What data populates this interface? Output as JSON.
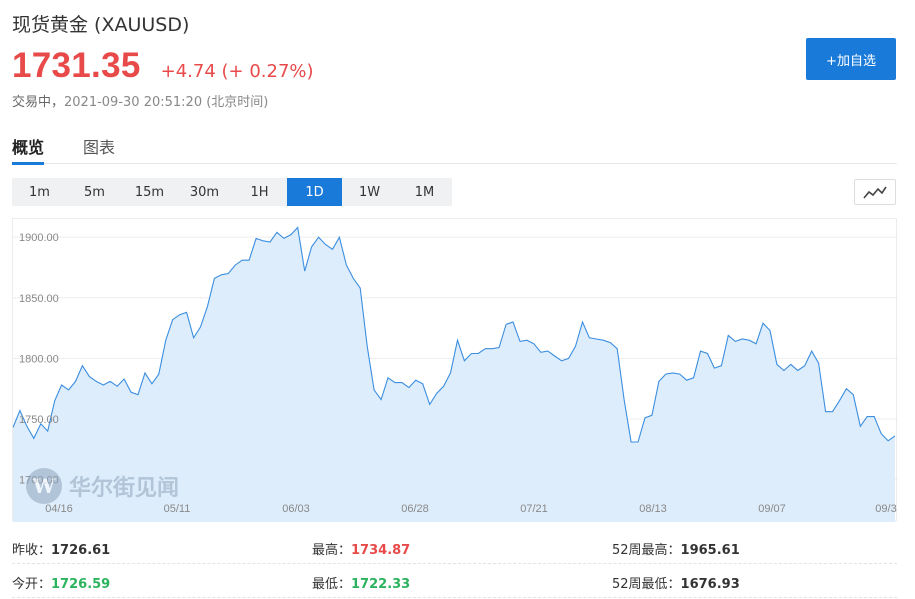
{
  "header": {
    "title": "现货黄金 (XAUUSD)",
    "price": "1731.35",
    "change": "+4.74 (+ 0.27%)",
    "status_label": "交易中，",
    "timestamp": "2021-09-30 20:51:20",
    "timezone": "(北京时间)",
    "add_button": "+加自选",
    "accent_color": "#1a7ad9",
    "up_color": "#e84a4a",
    "down_color": "#2bb35e"
  },
  "tabs": [
    {
      "label": "概览",
      "active": true
    },
    {
      "label": "图表",
      "active": false
    }
  ],
  "periods": [
    {
      "label": "1m",
      "active": false
    },
    {
      "label": "5m",
      "active": false
    },
    {
      "label": "15m",
      "active": false
    },
    {
      "label": "30m",
      "active": false
    },
    {
      "label": "1H",
      "active": false
    },
    {
      "label": "1D",
      "active": true
    },
    {
      "label": "1W",
      "active": false
    },
    {
      "label": "1M",
      "active": false
    }
  ],
  "chart_type_icon": "line-chart-icon",
  "watermark": "华尔街见闻",
  "chart_data": {
    "type": "area",
    "x_ticks": [
      "04/16",
      "05/11",
      "06/03",
      "06/28",
      "07/21",
      "08/13",
      "09/07",
      "09/3"
    ],
    "y_ticks": [
      "1900.00",
      "1850.00",
      "1800.00",
      "1750.00",
      "1700.00"
    ],
    "ylim": [
      1665,
      1915
    ],
    "grid": true,
    "line_color": "#3b8ee0",
    "fill_color": "#deedfb",
    "values": [
      1743,
      1757,
      1744,
      1734,
      1746,
      1740,
      1765,
      1778,
      1774,
      1781,
      1794,
      1785,
      1781,
      1778,
      1781,
      1777,
      1783,
      1772,
      1770,
      1788,
      1779,
      1787,
      1815,
      1832,
      1836,
      1838,
      1817,
      1826,
      1843,
      1866,
      1869,
      1870,
      1877,
      1881,
      1881,
      1899,
      1897,
      1896,
      1904,
      1899,
      1902,
      1908,
      1872,
      1892,
      1900,
      1894,
      1890,
      1900,
      1877,
      1866,
      1858,
      1810,
      1774,
      1766,
      1784,
      1780,
      1780,
      1776,
      1782,
      1779,
      1762,
      1771,
      1777,
      1788,
      1815,
      1798,
      1804,
      1804,
      1808,
      1808,
      1809,
      1828,
      1830,
      1814,
      1815,
      1812,
      1805,
      1806,
      1802,
      1798,
      1800,
      1810,
      1830,
      1817,
      1816,
      1815,
      1813,
      1808,
      1766,
      1731,
      1731,
      1751,
      1753,
      1781,
      1787,
      1788,
      1787,
      1782,
      1784,
      1806,
      1804,
      1792,
      1794,
      1819,
      1814,
      1816,
      1815,
      1812,
      1829,
      1823,
      1795,
      1790,
      1795,
      1790,
      1794,
      1806,
      1796,
      1756,
      1756,
      1765,
      1775,
      1770,
      1744,
      1752,
      1752,
      1738,
      1732,
      1736
    ]
  },
  "stats": {
    "prev_close_label": "昨收：",
    "prev_close": "1726.61",
    "open_label": "今开：",
    "open": "1726.59",
    "high_label": "最高：",
    "high": "1734.87",
    "low_label": "最低：",
    "low": "1722.33",
    "w52_high_label": "52周最高：",
    "w52_high": "1965.61",
    "w52_low_label": "52周最低：",
    "w52_low": "1676.93"
  }
}
